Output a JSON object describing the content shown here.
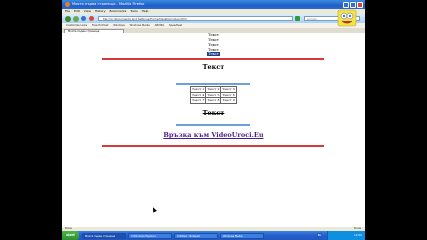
{
  "window": {
    "title": "Моята първа страница - Mozilla Firefox"
  },
  "menu": [
    "File",
    "Edit",
    "View",
    "History",
    "Bookmarks",
    "Tools",
    "Help"
  ],
  "navigation": {
    "url": "file:///C:/Documents and Settings/Home/Desktop/index.html",
    "search_placeholder": "Google"
  },
  "bookmarks": [
    "Customize Links",
    "Free Hotmail",
    "Windows",
    "Windows Media",
    "ABV.BG",
    "Speedtest"
  ],
  "tab": {
    "label": "Моята първа страница"
  },
  "page": {
    "lines": [
      "Текст",
      "Текст",
      "Текст",
      "Текст",
      "Текст"
    ],
    "heading": "Текст",
    "table": [
      [
        "Текст 1",
        "Текст 2",
        "Текст 3"
      ],
      [
        "Текст 4",
        "Текст 5",
        "Текст 6"
      ],
      [
        "Текст 7",
        "Текст 8",
        "Текст 9"
      ]
    ],
    "strike_heading": "Текст",
    "link_text": "Връзка към VideoUroci.Eu"
  },
  "status": {
    "left": "Done",
    "right": "Done"
  },
  "taskbar": {
    "start": "start",
    "tasks": [
      "Моята първа страница",
      "3 Windows Explorer",
      "Untitled - Notepad",
      "Windows Media"
    ],
    "lang": "BG",
    "clock": "12:02"
  }
}
